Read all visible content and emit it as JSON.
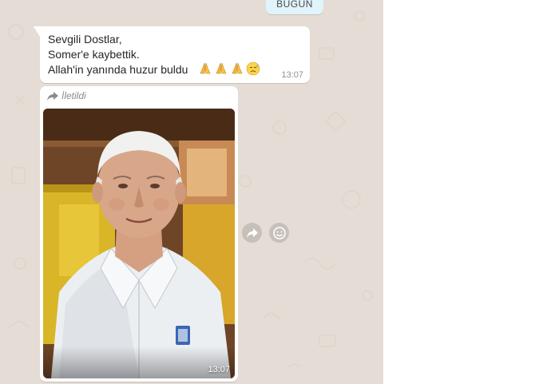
{
  "date_divider": "BUGÜN",
  "message": {
    "lines": [
      "Sevgili Dostlar,",
      "Somer'e kaybettik.",
      "Allah'in yanında huzur buldu"
    ],
    "emojis": [
      "folded-hands",
      "folded-hands",
      "folded-hands",
      "sad-relieved-face"
    ],
    "time": "13:07"
  },
  "image_message": {
    "forwarded_label": "İletildi",
    "time": "13:07"
  },
  "actions": {
    "forward_icon": "forward-icon",
    "emoji_icon": "smiley-icon"
  },
  "colors": {
    "chat_background": "#e5ddd5",
    "bubble": "#ffffff",
    "date_chip": "#e1f3fb"
  }
}
